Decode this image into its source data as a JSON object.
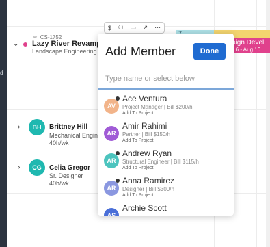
{
  "left_bar": {
    "tick": "d"
  },
  "project": {
    "id": "CS-1752",
    "name": "Lazy River Revamp",
    "subtitle": "Landscape Engineering"
  },
  "people": [
    {
      "initials": "BH",
      "name": "Brittney Hill",
      "role": "Mechanical Engineer",
      "hours": "40h/wk"
    },
    {
      "initials": "CG",
      "name": "Celia Gregor",
      "role": "Sr. Designer",
      "hours": "40h/wk"
    }
  ],
  "schedule_bars": {
    "teal_label": "7",
    "pink_label": "esign Devel",
    "pink_dates": "y 16 - Aug 10"
  },
  "toolbar": {
    "icons": [
      "$",
      "person",
      "card",
      "open",
      "..."
    ]
  },
  "popup": {
    "title": "Add Member",
    "done_label": "Done",
    "search_placeholder": "Type name or select below",
    "search_value": "",
    "members": [
      {
        "initials": "AV",
        "name": "Ace Ventura",
        "detail": "Project Manager | Bill $200/h",
        "action": "Add To Project",
        "color": "#f2b48a",
        "online": true
      },
      {
        "initials": "AR",
        "name": "Amir Rahimi",
        "detail": "Partner | Bill $150/h",
        "action": "Add To Project",
        "color": "#a05bd6",
        "online": false
      },
      {
        "initials": "AR",
        "name": "Andrew Ryan",
        "detail": "Structural Engineer | Bill $115/h",
        "action": "Add To Project",
        "color": "#4cc4be",
        "online": true
      },
      {
        "initials": "AR",
        "name": "Anna Ramirez",
        "detail": "Designer | Bill $300/h",
        "action": "Add To Project",
        "color": "#8a97e0",
        "online": true
      },
      {
        "initials": "AS",
        "name": "Archie Scott",
        "detail": "",
        "action": "",
        "color": "#4a6fd8",
        "online": false
      }
    ]
  }
}
